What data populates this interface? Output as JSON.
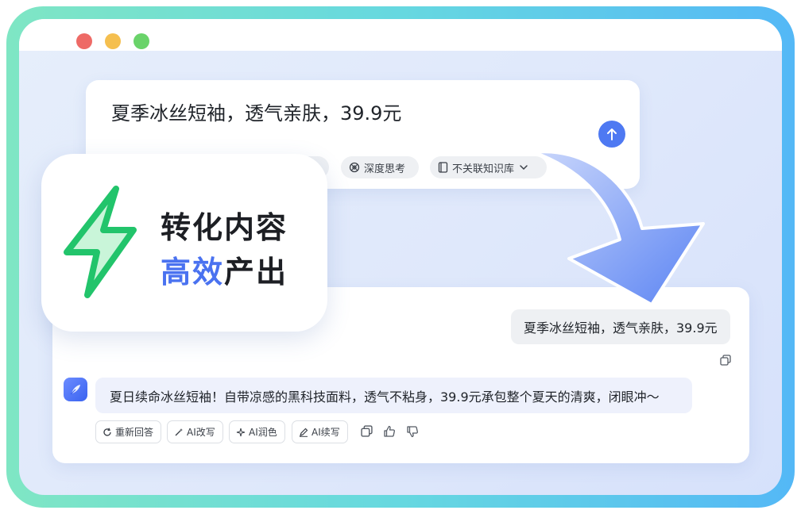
{
  "window": {
    "controls": [
      "close",
      "minimize",
      "maximize"
    ]
  },
  "input": {
    "text": "夏季冰丝短袖，透气亲肤，39.9元",
    "send_icon": "arrow-up-icon"
  },
  "options": {
    "deep_think_label": "深度思考",
    "knowledge_base_label": "不关联知识库"
  },
  "badge": {
    "line1": "转化内容",
    "line2_accent": "高效",
    "line2_rest": "产出",
    "icon": "lightning-icon"
  },
  "chat": {
    "user_message": "夏季冰丝短袖，透气亲肤，39.9元",
    "ai_message": "夏日续命冰丝短袖！自带凉感的黑科技面料，透气不粘身，39.9元承包整个夏天的清爽，闭眼冲～",
    "actions": {
      "regenerate": "重新回答",
      "rewrite": "AI改写",
      "polish": "AI润色",
      "continue": "AI续写"
    }
  },
  "colors": {
    "accent": "#4e79f2",
    "bolt": "#22c46b",
    "frame_start": "#7fe6c4",
    "frame_end": "#54b8f6"
  }
}
